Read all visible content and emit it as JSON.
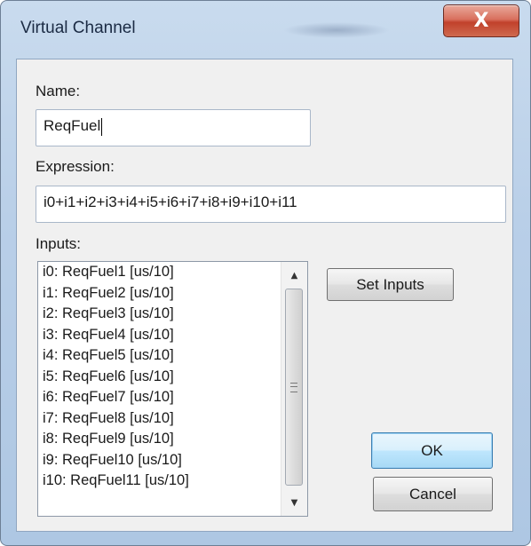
{
  "window": {
    "title": "Virtual Channel",
    "close_label": "X"
  },
  "form": {
    "name_label": "Name:",
    "name_value": "ReqFuel",
    "expression_label": "Expression:",
    "expression_value": "i0+i1+i2+i3+i4+i5+i6+i7+i8+i9+i10+i11",
    "inputs_label": "Inputs:",
    "inputs": [
      "i0: ReqFuel1 [us/10]",
      "i1: ReqFuel2 [us/10]",
      "i2: ReqFuel3 [us/10]",
      "i3: ReqFuel4 [us/10]",
      "i4: ReqFuel5 [us/10]",
      "i5: ReqFuel6 [us/10]",
      "i6: ReqFuel7 [us/10]",
      "i7: ReqFuel8 [us/10]",
      "i8: ReqFuel9 [us/10]",
      "i9: ReqFuel10 [us/10]",
      "i10: ReqFuel11 [us/10]"
    ]
  },
  "buttons": {
    "set_inputs": "Set Inputs",
    "ok": "OK",
    "cancel": "Cancel"
  }
}
